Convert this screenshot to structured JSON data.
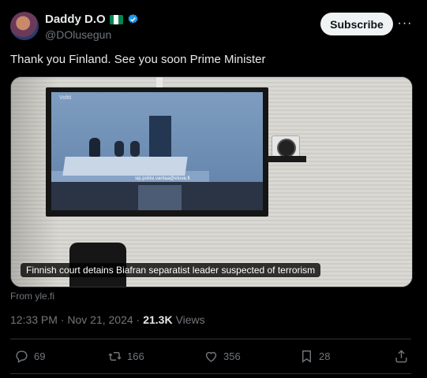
{
  "author": {
    "name": "Daddy D.O",
    "handle": "@DOlusegun",
    "flag_colors": [
      "#008751",
      "#ffffff",
      "#008751"
    ],
    "verified_color": "#1d9bf0"
  },
  "header": {
    "subscribe_label": "Subscribe",
    "more_label": "···"
  },
  "tweet": {
    "text": "Thank you Finland. See you soon Prime Minister",
    "card_caption": "Finnish court detains Biafran separatist leader suspected of terrorism",
    "card_source": "From yle.fi",
    "screen_overlay_text": "sip.poliisi.vantaa@etuve.fi",
    "screen_logo_text": "Voltti"
  },
  "meta": {
    "timestamp": "12:33 PM · Nov 21, 2024 ·",
    "views_count": "21.3K",
    "views_label": "Views"
  },
  "actions": {
    "replies": "69",
    "reposts": "166",
    "likes": "356",
    "bookmarks": "28"
  },
  "icons": {
    "reply": "reply-icon",
    "repost": "repost-icon",
    "like": "heart-icon",
    "bookmark": "bookmark-icon",
    "share": "share-icon"
  }
}
